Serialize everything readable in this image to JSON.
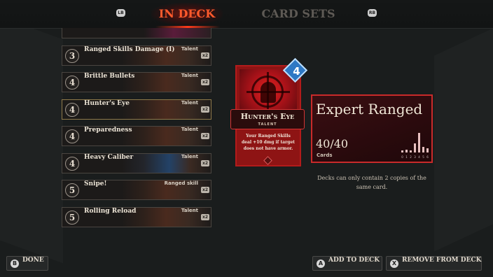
{
  "nav": {
    "lb_glyph": "LB",
    "rb_glyph": "RB",
    "tabs": [
      {
        "label": "IN DECK",
        "active": true
      },
      {
        "label": "CARD SETS",
        "active": false
      }
    ]
  },
  "deck_list": [
    {
      "cost": "3",
      "name": "Ranged Skills Damage (I)",
      "type": "Talent",
      "qty": "x2"
    },
    {
      "cost": "4",
      "name": "Brittle Bullets",
      "type": "Talent",
      "qty": "x2"
    },
    {
      "cost": "4",
      "name": "Hunter's Eye",
      "type": "Talent",
      "qty": "x2",
      "selected": true
    },
    {
      "cost": "4",
      "name": "Preparedness",
      "type": "Talent",
      "qty": "x2"
    },
    {
      "cost": "4",
      "name": "Heavy Caliber",
      "type": "Talent",
      "qty": "x2"
    },
    {
      "cost": "5",
      "name": "Snipe!",
      "type": "Ranged skill",
      "qty": "x2"
    },
    {
      "cost": "5",
      "name": "Rolling Reload",
      "type": "Talent",
      "qty": "x2"
    }
  ],
  "featured_card": {
    "cost": "4",
    "name": "Hunter's Eye",
    "type": "TALENT",
    "description": "Your Ranged Skills deal +10 dmg if target does not have armor."
  },
  "deck_summary": {
    "title": "Expert Ranged",
    "count": "40/40",
    "count_label": "Cards",
    "curve_labels": [
      "0",
      "1",
      "2",
      "3",
      "4",
      "5",
      "6"
    ],
    "curve_levels": [
      0.1,
      0.15,
      0.1,
      0.45,
      1.0,
      0.3,
      0.2
    ],
    "note": "Decks can only contain 2 copies of the same card."
  },
  "footer": {
    "done": {
      "glyph": "B",
      "label": "DONE"
    },
    "add": {
      "glyph": "A",
      "label": "ADD TO DECK"
    },
    "remove": {
      "glyph": "X",
      "label": "REMOVE FROM DECK"
    }
  },
  "colors": {
    "accent": "#ff5a2c",
    "card_red": "#8e1414",
    "cost_blue": "#2e78c4"
  }
}
